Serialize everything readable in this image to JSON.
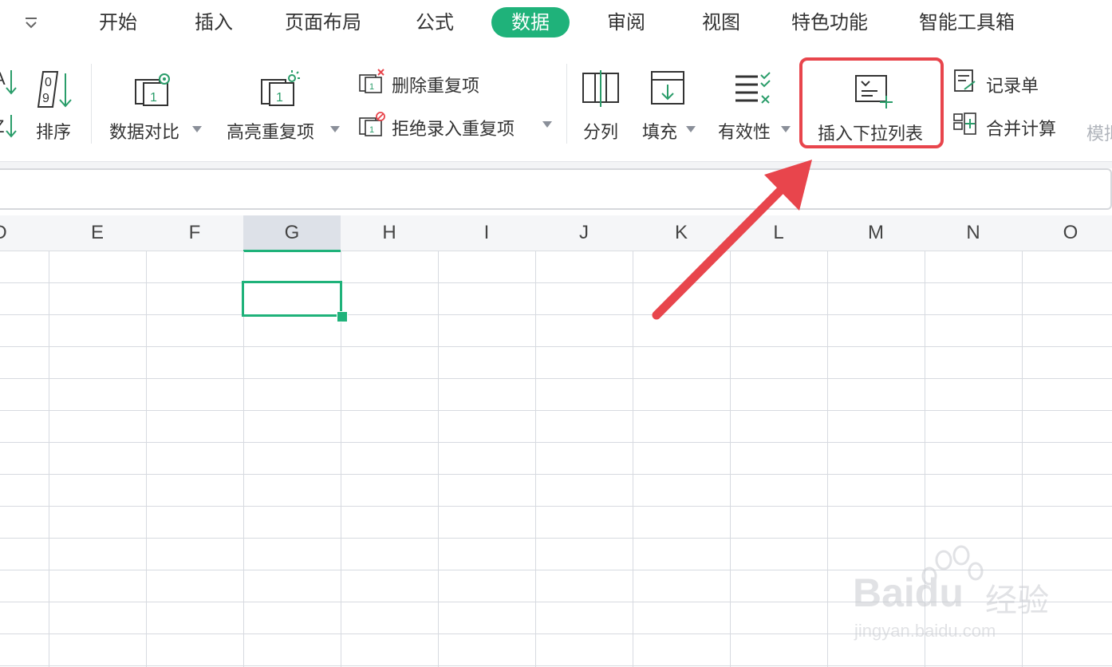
{
  "menu": {
    "tabs": [
      {
        "label": "开始"
      },
      {
        "label": "插入"
      },
      {
        "label": "页面布局"
      },
      {
        "label": "公式"
      },
      {
        "label": "数据"
      },
      {
        "label": "审阅"
      },
      {
        "label": "视图"
      },
      {
        "label": "特色功能"
      },
      {
        "label": "智能工具箱"
      }
    ],
    "active_tab": "数据",
    "accent_color": "#1fb27a"
  },
  "ribbon": {
    "sort": {
      "label": "排序",
      "icon_digits": [
        "0",
        "9"
      ]
    },
    "data_compare": {
      "label": "数据对比",
      "icon": "data-compare-icon"
    },
    "highlight_duplicates": {
      "label": "高亮重复项",
      "icon": "highlight-duplicates-icon"
    },
    "remove_duplicates": {
      "label": "删除重复项",
      "icon": "remove-duplicates-icon"
    },
    "reject_duplicates": {
      "label": "拒绝录入重复项",
      "icon": "reject-duplicates-icon"
    },
    "split_column": {
      "label": "分列",
      "icon": "split-column-icon"
    },
    "fill": {
      "label": "填充",
      "icon": "fill-icon"
    },
    "validation": {
      "label": "有效性",
      "icon": "validation-icon"
    },
    "insert_dropdown": {
      "label": "插入下拉列表",
      "icon": "insert-dropdown-list-icon"
    },
    "record_form": {
      "label": "记录单",
      "icon": "record-form-icon"
    },
    "consolidate": {
      "label": "合并计算",
      "icon": "consolidate-icon"
    },
    "truncated_next": {
      "label": "模拟"
    },
    "highlight_color": "#e8454c"
  },
  "grid": {
    "columns": [
      "D",
      "E",
      "F",
      "G",
      "H",
      "I",
      "J",
      "K",
      "L",
      "M",
      "N",
      "O"
    ],
    "selected_column": "G"
  },
  "watermark": {
    "brand": "Baidu",
    "suffix": "经验",
    "url": "jingyan.baidu.com"
  }
}
